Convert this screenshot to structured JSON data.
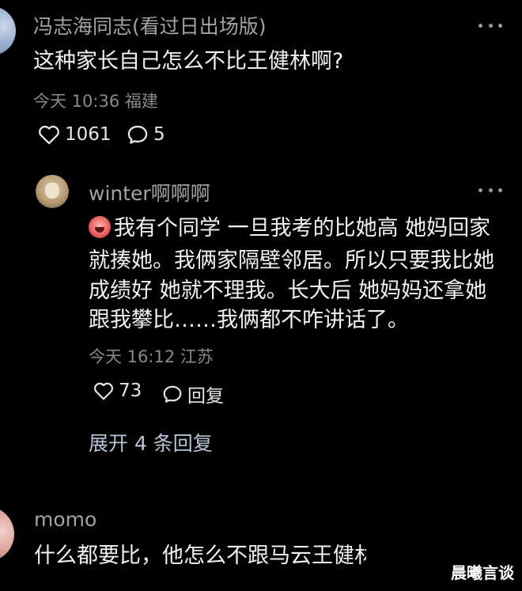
{
  "comments": [
    {
      "user": "冯志海同志(看过日出场版)",
      "text": "这种家长自己怎么不比王健林啊?",
      "meta": "今天 10:36 福建",
      "likes": "1061",
      "replies": "5"
    },
    {
      "user": "winter啊啊啊",
      "lines": [
        "我有个同学 一旦我考的比她高 她妈回家",
        "就揍她。我俩家隔壁邻居。所以只要我比她",
        "成绩好 她就不理我。长大后 她妈妈还拿她",
        "跟我攀比……我俩都不咋讲话了。"
      ],
      "meta": "今天 16:12 江苏",
      "likes": "73",
      "reply_label": "回复",
      "expand": "展开 4 条回复"
    },
    {
      "user": "momo",
      "text": "什么都要比，他怎么不跟马云王健林"
    }
  ],
  "watermark": "晨曦言谈",
  "icons": {
    "like": "heart-icon",
    "comment": "comment-bubble-icon",
    "more": "more-dots-icon",
    "emoji": "crying-face-emoji-icon"
  }
}
